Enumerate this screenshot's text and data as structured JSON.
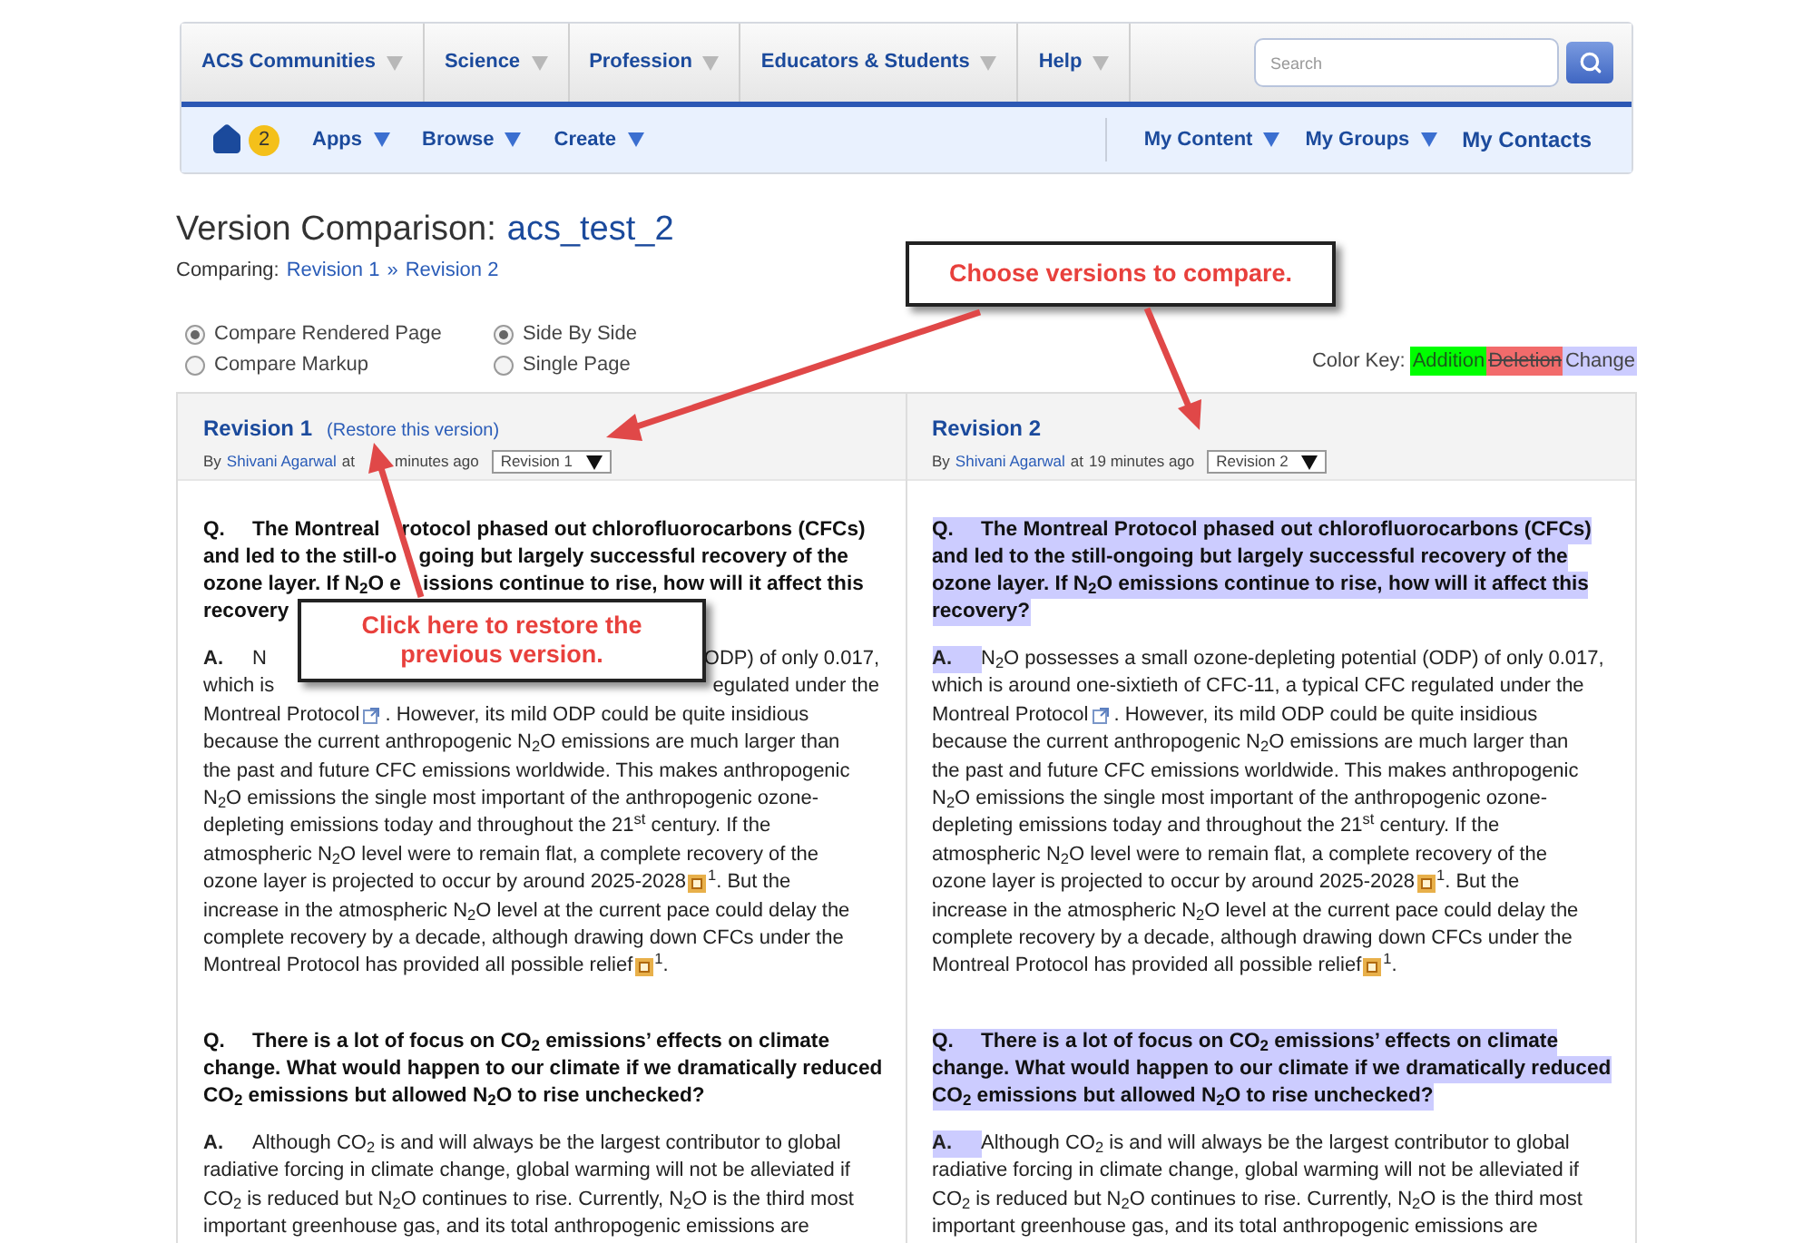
{
  "nav": {
    "primary": [
      {
        "label": "ACS Communities"
      },
      {
        "label": "Science"
      },
      {
        "label": "Profession"
      },
      {
        "label": "Educators & Students"
      },
      {
        "label": "Help"
      }
    ],
    "search": {
      "placeholder": "Search"
    },
    "notification_count": "2",
    "secondary_left": [
      {
        "label": "Apps",
        "dropdown": true
      },
      {
        "label": "Browse",
        "dropdown": true
      },
      {
        "label": "Create",
        "dropdown": true
      }
    ],
    "secondary_right": [
      {
        "label": "My Content",
        "dropdown": true
      },
      {
        "label": "My Groups",
        "dropdown": true
      },
      {
        "label": "My Contacts",
        "dropdown": false
      }
    ]
  },
  "header": {
    "title": "Version Comparison:",
    "document": "acs_test_2",
    "comparing_label": "Comparing:",
    "from": "Revision 1",
    "separator": "»",
    "to": "Revision 2"
  },
  "options": {
    "render_mode": [
      {
        "label": "Compare Rendered Page",
        "selected": true
      },
      {
        "label": "Compare Markup",
        "selected": false
      }
    ],
    "layout": [
      {
        "label": "Side By Side",
        "selected": true
      },
      {
        "label": "Single Page",
        "selected": false
      }
    ]
  },
  "color_key": {
    "label": "Color Key:",
    "entries": [
      {
        "label": "Addition",
        "kind": "addition",
        "color": "#00ff00"
      },
      {
        "label": "Deletion",
        "kind": "deletion",
        "color": "#f26b6b"
      },
      {
        "label": "Change",
        "kind": "change",
        "color": "#ccccff"
      }
    ]
  },
  "revisions": [
    {
      "title": "Revision 1",
      "restore_link": "(Restore this version)",
      "by": "By",
      "author": "Shivani Agarwal",
      "at": "at",
      "time": "minutes ago",
      "select": "Revision 1",
      "paragraphs": [
        {
          "kind": "question",
          "marker": "Q.",
          "marker_changed": false,
          "changed": false,
          "lines": [
            [
              {
                "kind": "text",
                "text": "The Montreal"
              },
              {
                "kind": "hidden"
              },
              {
                "kind": "text",
                "text": "rotocol phased out chlorofluorocarbons (CFCs)"
              }
            ],
            [
              {
                "kind": "text",
                "text": "and led to the still-o"
              },
              {
                "kind": "hidden"
              },
              {
                "kind": "text",
                "text": "going but largely successful recovery of the"
              }
            ],
            [
              {
                "kind": "text",
                "text": "ozone layer. If N$_{2}$O e"
              },
              {
                "kind": "hidden"
              },
              {
                "kind": "text",
                "text": "issions continue to rise, how will it affect this"
              }
            ],
            "recovery"
          ]
        },
        {
          "kind": "answer",
          "marker": "A.",
          "marker_changed": false,
          "changed": false,
          "lines": [
            [
              {
                "kind": "text",
                "text": "N"
              },
              {
                "kind": "gap"
              },
              {
                "kind": "text",
                "text": "ODP) of only 0.017,"
              }
            ],
            [
              {
                "kind": "text",
                "text": "which is"
              },
              {
                "kind": "gap"
              },
              {
                "kind": "text",
                "text": "egulated under the"
              }
            ],
            [
              {
                "kind": "text",
                "text": "Montreal Protocol"
              },
              {
                "kind": "link_icon"
              },
              {
                "kind": "text",
                "text": ". However, its mild ODP could be quite insidious"
              }
            ],
            "because the current anthropogenic N$_{2}$O emissions are much larger than",
            "the past and future CFC emissions worldwide. This makes anthropogenic",
            "N$_{2}$O emissions the single most important of the anthropogenic ozone-",
            "depleting emissions today and throughout the 21$^{st}$ century. If the",
            "atmospheric N$_{2}$O level were to remain flat, a complete recovery of the",
            [
              {
                "kind": "text",
                "text": "ozone layer is projected to occur by around 2025-2028"
              },
              {
                "kind": "ref_icon"
              },
              {
                "kind": "text",
                "text": "$^{1}$. But the"
              }
            ],
            "increase in the atmospheric N$_{2}$O level at the current pace could delay the",
            "complete recovery by a decade, although drawing down CFCs under the",
            [
              {
                "kind": "text",
                "text": "Montreal Protocol has provided all possible relief"
              },
              {
                "kind": "ref_icon"
              },
              {
                "kind": "text",
                "text": "$^{1}$."
              }
            ]
          ]
        },
        {
          "kind": "question",
          "marker": "Q.",
          "marker_changed": false,
          "changed": false,
          "lines": [
            "There is a lot of focus on CO$_{2}$ emissions’ effects on climate",
            "change. What would happen to our climate if we dramatically reduced",
            "CO$_{2}$ emissions but allowed N$_{2}$O to rise unchecked?"
          ]
        },
        {
          "kind": "answer",
          "marker": "A.",
          "marker_changed": false,
          "changed": false,
          "lines": [
            "Although CO$_{2}$ is and will always be the largest contributor to global",
            "radiative forcing in climate change, global warming will not be alleviated if",
            "CO$_{2}$ is reduced but N$_{2}$O continues to rise. Currently, N$_{2}$O is the third most",
            "important greenhouse gas, and its total anthropogenic emissions are"
          ]
        }
      ]
    },
    {
      "title": "Revision 2",
      "by": "By",
      "author": "Shivani Agarwal",
      "at": "at",
      "time": "19 minutes ago",
      "select": "Revision 2",
      "paragraphs": [
        {
          "kind": "question",
          "marker": "Q.",
          "marker_changed": true,
          "changed": true,
          "lines": [
            "The Montreal Protocol phased out chlorofluorocarbons (CFCs)",
            "and led to the still-ongoing but largely successful recovery of the",
            "ozone layer. If N$_{2}$O emissions continue to rise, how will it affect this",
            "recovery?"
          ]
        },
        {
          "kind": "answer",
          "marker": "A.",
          "marker_changed": true,
          "changed": false,
          "lines": [
            "N$_{2}$O possesses a small ozone-depleting potential (ODP) of only 0.017,",
            "which is around one-sixtieth of CFC-11, a typical CFC regulated under the",
            [
              {
                "kind": "text",
                "text": "Montreal Protocol"
              },
              {
                "kind": "link_icon"
              },
              {
                "kind": "text",
                "text": ". However, its mild ODP could be quite insidious"
              }
            ],
            "because the current anthropogenic N$_{2}$O emissions are much larger than",
            "the past and future CFC emissions worldwide. This makes anthropogenic",
            "N$_{2}$O emissions the single most important of the anthropogenic ozone-",
            "depleting emissions today and throughout the 21$^{st}$ century. If the",
            "atmospheric N$_{2}$O level were to remain flat, a complete recovery of the",
            [
              {
                "kind": "text",
                "text": "ozone layer is projected to occur by around 2025-2028"
              },
              {
                "kind": "ref_icon"
              },
              {
                "kind": "text",
                "text": "$^{1}$. But the"
              }
            ],
            "increase in the atmospheric N$_{2}$O level at the current pace could delay the",
            "complete recovery by a decade, although drawing down CFCs under the",
            [
              {
                "kind": "text",
                "text": "Montreal Protocol has provided all possible relief"
              },
              {
                "kind": "ref_icon"
              },
              {
                "kind": "text",
                "text": "$^{1}$."
              }
            ]
          ]
        },
        {
          "kind": "question",
          "marker": "Q.",
          "marker_changed": true,
          "changed": true,
          "lines": [
            "There is a lot of focus on CO$_{2}$ emissions’ effects on climate",
            "change. What would happen to our climate if we dramatically reduced",
            "CO$_{2}$ emissions but allowed N$_{2}$O to rise unchecked?"
          ]
        },
        {
          "kind": "answer",
          "marker": "A.",
          "marker_changed": true,
          "changed": false,
          "lines": [
            "Although CO$_{2}$ is and will always be the largest contributor to global",
            "radiative forcing in climate change, global warming will not be alleviated if",
            "CO$_{2}$ is reduced but N$_{2}$O continues to rise. Currently, N$_{2}$O is the third most",
            "important greenhouse gas, and its total anthropogenic emissions are"
          ]
        }
      ]
    }
  ],
  "callouts": [
    {
      "lines": [
        "Choose versions to compare."
      ]
    },
    {
      "lines": [
        "Click here to restore the",
        "previous version."
      ]
    }
  ]
}
